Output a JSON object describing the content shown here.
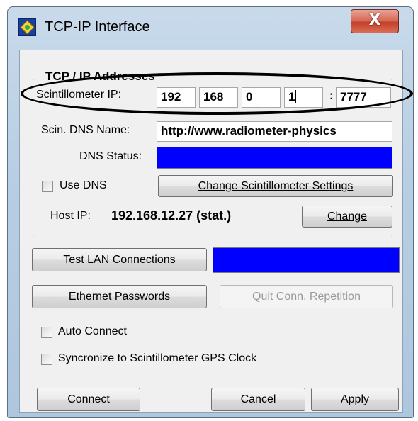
{
  "window": {
    "title": "TCP-IP Interface",
    "close_label": "X"
  },
  "group": {
    "title": "TCP / IP Addresses"
  },
  "ip": {
    "label": "Scintillometer  IP:",
    "octets": [
      "192",
      "168",
      "0",
      "1"
    ],
    "port_separator": ":",
    "port": "7777"
  },
  "dns": {
    "name_label": "Scin. DNS Name:",
    "name_value": "http://www.radiometer-physics",
    "status_label": "DNS Status:",
    "status_color": "#0000ff"
  },
  "use_dns": {
    "label": "Use DNS",
    "checked": false
  },
  "buttons": {
    "change_scintillometer_settings": "Change Scintillometer Settings",
    "change": "Change",
    "test_lan": "Test LAN Connections",
    "ethernet_passwords": "Ethernet Passwords",
    "quit_conn_repetition": "Quit Conn. Repetition",
    "connect": "Connect",
    "cancel": "Cancel",
    "apply": "Apply"
  },
  "host": {
    "label": "Host  IP:",
    "value": "192.168.12.27 (stat.)"
  },
  "lan_status_color": "#0000ff",
  "options": {
    "auto_connect": {
      "label": "Auto Connect",
      "checked": false
    },
    "sync_gps": {
      "label": "Syncronize to Scintillometer GPS Clock",
      "checked": false
    }
  }
}
